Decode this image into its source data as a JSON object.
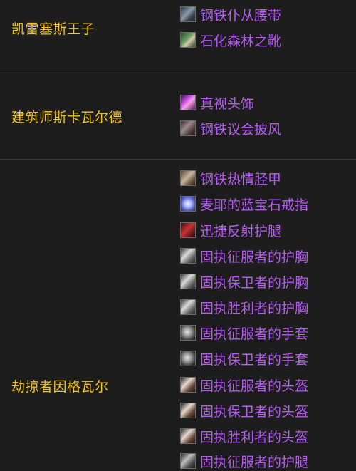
{
  "bosses": [
    {
      "name": "凯雷塞斯王子",
      "items": [
        {
          "icon": "belt-icon",
          "label": "钢铁仆从腰带"
        },
        {
          "icon": "boots-icon",
          "label": "石化森林之靴"
        }
      ]
    },
    {
      "name": "建筑师斯卡瓦尔德",
      "items": [
        {
          "icon": "helm-icon",
          "label": "真视头饰"
        },
        {
          "icon": "cloak-icon",
          "label": "钢铁议会披风"
        }
      ]
    },
    {
      "name": "劫掠者因格瓦尔",
      "items": [
        {
          "icon": "chest-armor-icon",
          "label": "钢铁热情胫甲"
        },
        {
          "icon": "ring-icon",
          "label": "麦耶的蓝宝石戒指"
        },
        {
          "icon": "legs-armor-icon",
          "label": "迅捷反射护腿"
        },
        {
          "icon": "tier-chest-icon",
          "label": "固执征服者的护胸"
        },
        {
          "icon": "tier-chest-icon",
          "label": "固执保卫者的护胸"
        },
        {
          "icon": "tier-chest-icon",
          "label": "固执胜利者的护胸"
        },
        {
          "icon": "tier-gloves-icon",
          "label": "固执征服者的手套"
        },
        {
          "icon": "tier-gloves-icon",
          "label": "固执保卫者的手套"
        },
        {
          "icon": "tier-helm-icon",
          "label": "固执征服者的头盔"
        },
        {
          "icon": "tier-helm-icon",
          "label": "固执保卫者的头盔"
        },
        {
          "icon": "tier-helm-icon",
          "label": "固执胜利者的头盔"
        },
        {
          "icon": "tier-legs-icon",
          "label": "固执征服者的护腿"
        }
      ]
    }
  ],
  "colors": {
    "boss_name": "#f2c519",
    "item_epic": "#b45cf0",
    "background": "#1d1d1d",
    "divider": "#3a3a3a"
  }
}
